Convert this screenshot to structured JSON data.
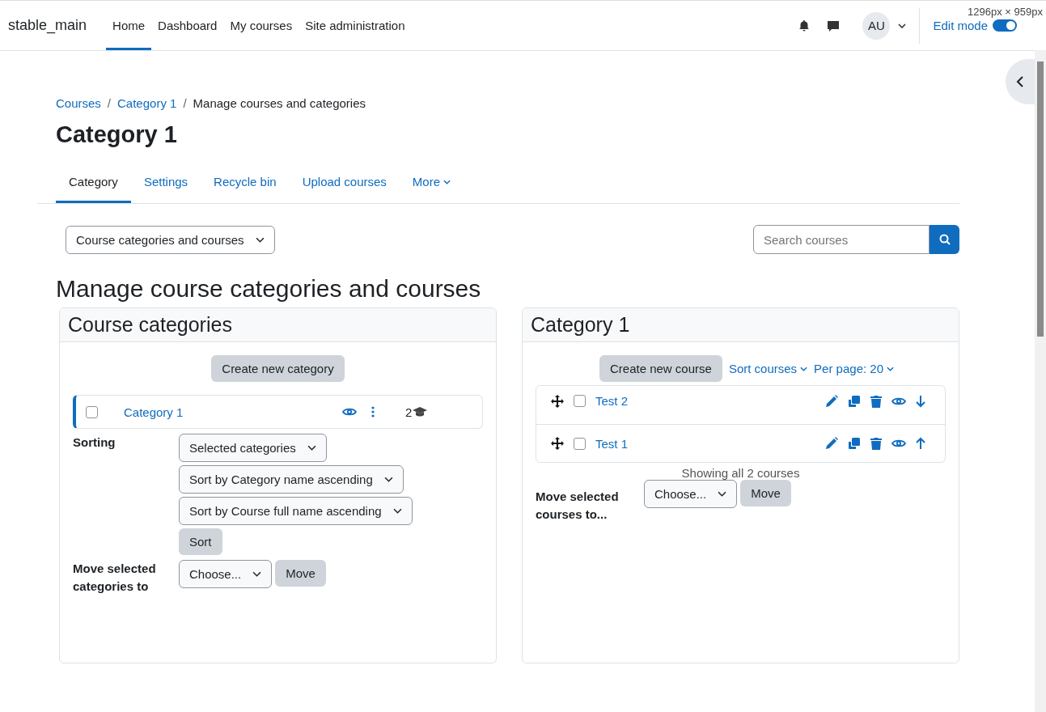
{
  "navbar": {
    "site_name": "stable_main",
    "items": [
      {
        "label": "Home",
        "selected": true
      },
      {
        "label": "Dashboard",
        "selected": false
      },
      {
        "label": "My courses",
        "selected": false
      },
      {
        "label": "Site administration",
        "selected": false
      }
    ],
    "avatar": "AU",
    "edit_mode": {
      "label": "Edit mode",
      "on": true
    },
    "size_label": "1296px × 959px"
  },
  "breadcrumb": {
    "separator": "/",
    "items": [
      {
        "label": "Courses",
        "link": true
      },
      {
        "label": "Category 1",
        "link": true
      },
      {
        "label": "Manage courses and categories",
        "link": false
      }
    ]
  },
  "page_title": "Category 1",
  "tabs": [
    {
      "label": "Category",
      "selected": true
    },
    {
      "label": "Settings",
      "selected": false
    },
    {
      "label": "Recycle bin",
      "selected": false
    },
    {
      "label": "Upload courses",
      "selected": false
    },
    {
      "label": "More",
      "selected": false
    }
  ],
  "view_select": "Course categories and courses",
  "search": {
    "placeholder": "Search courses"
  },
  "heading": "Manage course categories and courses",
  "categories_panel": {
    "title": "Course categories",
    "create_button": "Create new category",
    "categories": [
      {
        "name": "Category 1",
        "checked": false,
        "course_count": "2"
      }
    ],
    "sorting_label": "Sorting",
    "sorting_selects": [
      "Selected categories",
      "Sort by Category name ascending",
      "Sort by Course full name ascending"
    ],
    "sort_button": "Sort",
    "move_label": "Move selected categories to",
    "move_select": "Choose...",
    "move_button": "Move"
  },
  "courses_panel": {
    "title": "Category 1",
    "create_button": "Create new course",
    "sort_link": "Sort courses",
    "per_page_link": "Per page: 20",
    "courses": [
      {
        "name": "Test 2",
        "checked": false,
        "kind": "down"
      },
      {
        "name": "Test 1",
        "checked": false,
        "kind": "up"
      }
    ],
    "summary": "Showing all 2 courses",
    "move_label": "Move selected courses to...",
    "move_select": "Choose...",
    "move_button": "Move"
  }
}
